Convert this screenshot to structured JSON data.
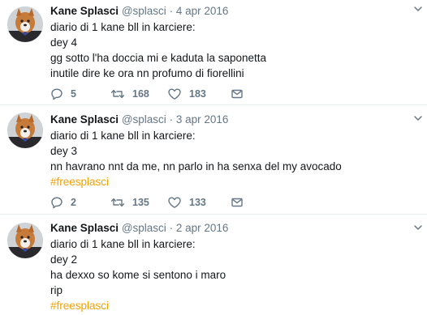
{
  "tweets": [
    {
      "name": "Kane Splasci",
      "handle": "@splasci",
      "separator": "·",
      "date": "4 apr 2016",
      "lines": [
        "diario di 1 kane bll in karciere:",
        "dey 4",
        "gg sotto l'ha doccia mi e kaduta la saponetta",
        "inutile dire ke ora nn profumo di fiorellini"
      ],
      "hashtag": "",
      "replies": "5",
      "retweets": "168",
      "likes": "183"
    },
    {
      "name": "Kane Splasci",
      "handle": "@splasci",
      "separator": "·",
      "date": "3 apr 2016",
      "lines": [
        "diario di 1 kane bll in karciere:",
        "dey 3",
        "nn havrano nnt da me, nn parlo in ha senxa del my avocado"
      ],
      "hashtag": "#freesplasci",
      "replies": "2",
      "retweets": "135",
      "likes": "133"
    },
    {
      "name": "Kane Splasci",
      "handle": "@splasci",
      "separator": "·",
      "date": "2 apr 2016",
      "lines": [
        "diario di 1 kane bll in karciere:",
        "dey 2",
        "ha dexxo so kome si sentono i maro",
        "rip"
      ],
      "hashtag": "#freesplasci"
    }
  ],
  "colors": {
    "text": "#14171a",
    "muted": "#657786",
    "hashtag": "#f5a200",
    "divider": "#e6ecf0"
  },
  "icons": {
    "reply": "reply-icon",
    "retweet": "retweet-icon",
    "like": "heart-icon",
    "dm": "direct-message-icon",
    "caret": "chevron-down-icon"
  }
}
